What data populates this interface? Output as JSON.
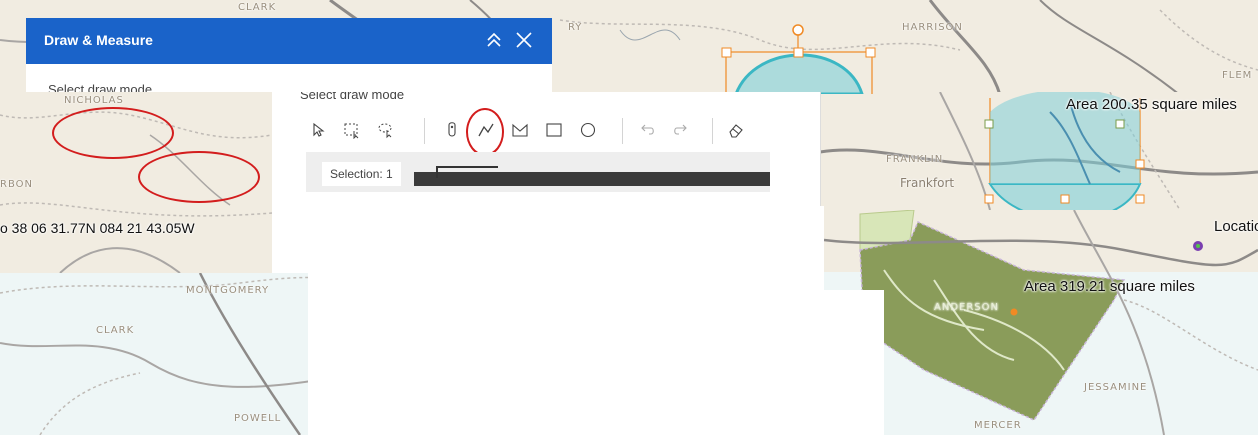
{
  "panel": {
    "title": "Draw & Measure",
    "mode_label": "Select draw mode",
    "selection_label": "Selection: 1",
    "collapse_icon": "chevron-double-up-icon",
    "close_icon": "close-icon"
  },
  "tools": [
    {
      "name": "select-tool",
      "icon": "cursor-icon"
    },
    {
      "name": "rectangle-select-tool",
      "icon": "rectangle-select-icon"
    },
    {
      "name": "lasso-select-tool",
      "icon": "lasso-select-icon"
    },
    {
      "name": "point-tool",
      "icon": "point-icon"
    },
    {
      "name": "polyline-tool",
      "icon": "polyline-icon",
      "highlighted": true
    },
    {
      "name": "polygon-tool",
      "icon": "polygon-icon"
    },
    {
      "name": "rectangle-tool",
      "icon": "rectangle-icon"
    },
    {
      "name": "circle-tool",
      "icon": "circle-icon"
    },
    {
      "name": "undo-tool",
      "icon": "undo-icon"
    },
    {
      "name": "redo-tool",
      "icon": "redo-icon"
    },
    {
      "name": "eraser-tool",
      "icon": "eraser-icon"
    }
  ],
  "map": {
    "counties": {
      "clark_top": "CLARK",
      "nicholas": "NICHOLAS",
      "bourbon_partial": "RBON",
      "montgomery": "MONTGOMERY",
      "clark": "CLARK",
      "powell": "POWELL",
      "harrison": "HARRISON",
      "franklin": "FRANKLIN",
      "jessamine": "JESSAMINE",
      "mercer": "MERCER",
      "ry_partial": "RY",
      "flem_partial": "FLEM",
      "woodford_partial": "ANDERSON"
    },
    "places": {
      "frankfort": "Frankfort"
    },
    "measurements": {
      "area_circle": "Area 200.35 square miles",
      "area_polygon": "Area 319.21 square miles",
      "coordinate": "o 38 06 31.77N 084 21 43.05W",
      "location_partial": "Locatio"
    }
  },
  "colors": {
    "header_blue": "#1a63c9",
    "highlight_red": "#d31d1d",
    "selection_orange": "#f08a24",
    "circle_fill": "#7fd0d8",
    "polygon_fill": "#8a9c5a"
  }
}
